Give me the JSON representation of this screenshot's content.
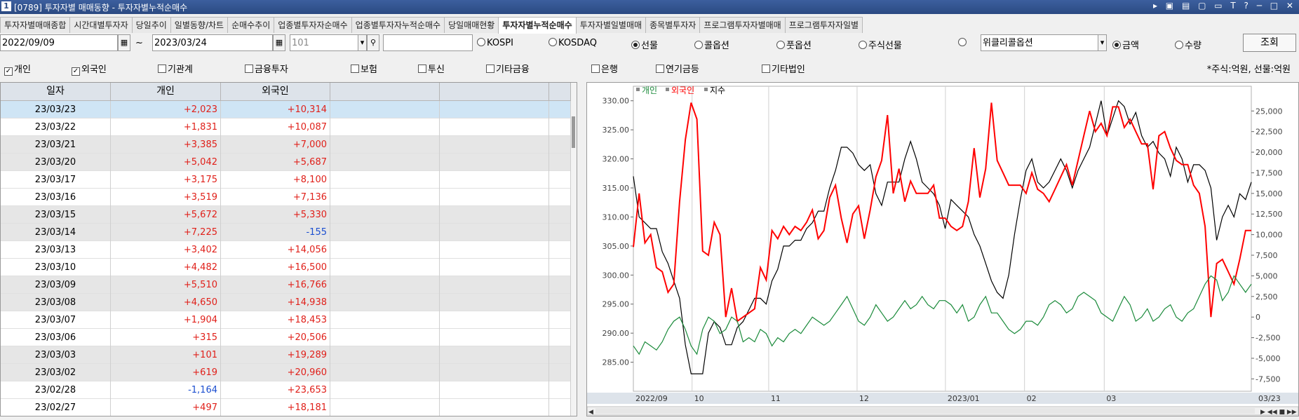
{
  "window": {
    "app_icon": "1",
    "title": "[0789] 투자자별 매매동향 - 투자자별누적순매수",
    "controls": "▸ ▣ ▤ ▢ ▭ T ? ─ □ ✕"
  },
  "tabs": [
    {
      "label": "투자자별매매종합",
      "active": false
    },
    {
      "label": "시간대별투자자",
      "active": false
    },
    {
      "label": "당일추이",
      "active": false
    },
    {
      "label": "일별동향/차트",
      "active": false
    },
    {
      "label": "순매수추이",
      "active": false
    },
    {
      "label": "업종별투자자순매수",
      "active": false
    },
    {
      "label": "업종별투자자누적순매수",
      "active": false
    },
    {
      "label": "당일매매현황",
      "active": false
    },
    {
      "label": "투자자별누적순매수",
      "active": true
    },
    {
      "label": "투자자별일별매매",
      "active": false
    },
    {
      "label": "종목별투자자",
      "active": false
    },
    {
      "label": "프로그램투자자별매매",
      "active": false
    },
    {
      "label": "프로그램투자자일별",
      "active": false
    }
  ],
  "toolbar": {
    "start_date": "2022/09/09",
    "tilde": "~",
    "end_date": "2023/03/24",
    "code": "101",
    "code_name": "",
    "market_options": [
      {
        "label": "KOSPI",
        "selected": false
      },
      {
        "label": "KOSDAQ",
        "selected": false
      },
      {
        "label": "선물",
        "selected": true
      },
      {
        "label": "콜옵션",
        "selected": false
      },
      {
        "label": "풋옵션",
        "selected": false
      },
      {
        "label": "주식선물",
        "selected": false
      },
      {
        "label": "",
        "selected": false
      }
    ],
    "option_select": "위클리콜옵션",
    "measure_options": [
      {
        "label": "금액",
        "selected": true
      },
      {
        "label": "수량",
        "selected": false
      }
    ],
    "query_button": "조회"
  },
  "investors": [
    {
      "label": "개인",
      "checked": true
    },
    {
      "label": "외국인",
      "checked": true
    },
    {
      "label": "기관계",
      "checked": false
    },
    {
      "label": "금융투자",
      "checked": false
    },
    {
      "label": "보험",
      "checked": false
    },
    {
      "label": "투신",
      "checked": false
    },
    {
      "label": "기타금융",
      "checked": false
    },
    {
      "label": "은행",
      "checked": false
    },
    {
      "label": "연기금등",
      "checked": false
    },
    {
      "label": "기타법인",
      "checked": false
    }
  ],
  "unit_note": "*주식:억원, 선물:억원",
  "table": {
    "headers": [
      "일자",
      "개인",
      "외국인"
    ],
    "rows": [
      [
        "23/03/23",
        "+2,023",
        "+10,314"
      ],
      [
        "23/03/22",
        "+1,831",
        "+10,087"
      ],
      [
        "23/03/21",
        "+3,385",
        "+7,000"
      ],
      [
        "23/03/20",
        "+5,042",
        "+5,687"
      ],
      [
        "23/03/17",
        "+3,175",
        "+8,100"
      ],
      [
        "23/03/16",
        "+3,519",
        "+7,136"
      ],
      [
        "23/03/15",
        "+5,672",
        "+5,330"
      ],
      [
        "23/03/14",
        "+7,225",
        "-155"
      ],
      [
        "23/03/13",
        "+3,402",
        "+14,056"
      ],
      [
        "23/03/10",
        "+4,482",
        "+16,500"
      ],
      [
        "23/03/09",
        "+5,510",
        "+16,766"
      ],
      [
        "23/03/08",
        "+4,650",
        "+14,938"
      ],
      [
        "23/03/07",
        "+1,904",
        "+18,453"
      ],
      [
        "23/03/06",
        "+315",
        "+20,506"
      ],
      [
        "23/03/03",
        "+101",
        "+19,289"
      ],
      [
        "23/03/02",
        "+619",
        "+20,960"
      ],
      [
        "23/02/28",
        "-1,164",
        "+23,653"
      ],
      [
        "23/02/27",
        "+497",
        "+18,181"
      ]
    ]
  },
  "chart_data": {
    "type": "line",
    "legend": [
      "개인",
      "외국인",
      "지수"
    ],
    "legend_placement": "top-left",
    "colors": {
      "개인": "#1a8a3a",
      "외국인": "#ff0000",
      "지수": "#000000"
    },
    "left_axis": {
      "min": 280,
      "max": 332.5,
      "ticks": [
        "285.00",
        "290.00",
        "295.00",
        "300.00",
        "305.00",
        "310.00",
        "315.00",
        "320.00",
        "325.00",
        "330.00"
      ]
    },
    "right_axis": {
      "min": -9000,
      "max": 28000,
      "ticks": [
        "-7,500",
        "-5,000",
        "-2,500",
        "0",
        "2,500",
        "5,000",
        "7,500",
        "10,000",
        "12,500",
        "15,000",
        "17,500",
        "20,000",
        "22,500",
        "25,000"
      ]
    },
    "x_ticks": [
      "2022/09",
      "10",
      "11",
      "12",
      "2023/01",
      "02",
      "03",
      "03/23"
    ],
    "series": [
      {
        "name": "지수",
        "axis": "left",
        "values": [
          317,
          310,
          309,
          308,
          308,
          304,
          302,
          299,
          296,
          288,
          283,
          283,
          283,
          290,
          292,
          291,
          288,
          288,
          291,
          292,
          294,
          296,
          296,
          295,
          299,
          301,
          305,
          305,
          306,
          306,
          308,
          309,
          311,
          311,
          315,
          318,
          322,
          322,
          321,
          319,
          318,
          319,
          314,
          312,
          316,
          316,
          316,
          320,
          323,
          320,
          316,
          315,
          314,
          312,
          308,
          313,
          312,
          311,
          310,
          307,
          305,
          302,
          299,
          297,
          296,
          300,
          307,
          313,
          318,
          320,
          316,
          315,
          316,
          318,
          320,
          318,
          315,
          318,
          320,
          322,
          326,
          330,
          324,
          327,
          330,
          329,
          326,
          328,
          324,
          322,
          323,
          321,
          320,
          317,
          322,
          320,
          316,
          319,
          319,
          318,
          315,
          306,
          310,
          312,
          310,
          314,
          313,
          316
        ]
      },
      {
        "name": "외국인",
        "axis": "right",
        "values": [
          8500,
          15000,
          9000,
          10000,
          6000,
          5500,
          3000,
          4000,
          14000,
          21500,
          26000,
          24000,
          8000,
          7500,
          11500,
          10000,
          0,
          3500,
          -500,
          0,
          500,
          1000,
          6000,
          4500,
          10500,
          9500,
          11000,
          10000,
          11000,
          10500,
          11500,
          13000,
          9500,
          10500,
          14500,
          16000,
          12000,
          9000,
          12500,
          13500,
          9500,
          13000,
          17000,
          19000,
          24500,
          15000,
          18000,
          14000,
          16500,
          15000,
          15000,
          15000,
          16000,
          12000,
          12000,
          11000,
          10500,
          11000,
          14000,
          20500,
          14500,
          18000,
          26000,
          19000,
          17500,
          16000,
          16000,
          16000,
          15000,
          17500,
          15500,
          15000,
          14000,
          15500,
          17000,
          18500,
          16000,
          19000,
          22000,
          25000,
          22500,
          23500,
          22000,
          25500,
          25500,
          23000,
          24000,
          22500,
          21000,
          21000,
          15500,
          22000,
          22500,
          20500,
          19000,
          18500,
          18500,
          16000,
          15000,
          11000,
          0,
          6500,
          7000,
          5500,
          4000,
          7000,
          10500,
          10500
        ]
      },
      {
        "name": "개인",
        "axis": "right",
        "values": [
          -3500,
          -4500,
          -3000,
          -3500,
          -4000,
          -3000,
          -1500,
          -500,
          0,
          -1500,
          -3500,
          -4500,
          -1500,
          0,
          -500,
          -2000,
          -1500,
          0,
          -500,
          -3000,
          -2500,
          -3000,
          -1500,
          -2000,
          -3500,
          -2500,
          -3000,
          -2000,
          -1500,
          -2000,
          -1000,
          0,
          -500,
          -1000,
          -500,
          500,
          1500,
          2500,
          1000,
          -500,
          -1000,
          0,
          1500,
          500,
          -500,
          0,
          1000,
          2000,
          1000,
          1500,
          2500,
          1500,
          1000,
          2000,
          2000,
          1500,
          500,
          1500,
          -500,
          0,
          1500,
          2500,
          500,
          500,
          -500,
          -1500,
          -2000,
          -1500,
          -500,
          -500,
          -1000,
          0,
          1500,
          2000,
          1500,
          500,
          1000,
          2500,
          3000,
          2500,
          2000,
          500,
          0,
          -500,
          1000,
          2500,
          1500,
          -500,
          0,
          1000,
          -500,
          0,
          1000,
          1500,
          0,
          -500,
          500,
          1000,
          2500,
          4000,
          5000,
          4500,
          2000,
          3000,
          5000,
          4000,
          3000,
          4000
        ]
      }
    ]
  }
}
